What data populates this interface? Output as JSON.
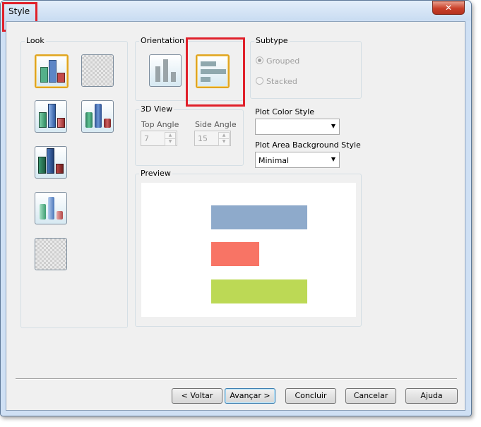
{
  "window": {
    "title": "Style",
    "close_glyph": "✕"
  },
  "look": {
    "label": "Look",
    "tiles": [
      {
        "name": "look-tile-flat-bars",
        "selected": true
      },
      {
        "name": "look-tile-transparent",
        "selected": false
      },
      {
        "name": "look-tile-beveled-bars",
        "selected": false
      },
      {
        "name": "look-tile-cylinder-bars",
        "selected": false
      },
      {
        "name": "look-tile-3d-bars",
        "selected": false
      },
      {
        "name": "look-tile-glossy-bars",
        "selected": false
      },
      {
        "name": "look-tile-transparent-2",
        "selected": false
      }
    ]
  },
  "orientation": {
    "label": "Orientation",
    "options": [
      "vertical",
      "horizontal"
    ],
    "selected": "horizontal"
  },
  "subtype": {
    "label": "Subtype",
    "grouped": "Grouped",
    "stacked": "Stacked",
    "selected": "Grouped"
  },
  "view3d": {
    "label": "3D View",
    "top_angle_label": "Top Angle",
    "top_angle": "7",
    "side_angle_label": "Side Angle",
    "side_angle": "15"
  },
  "plot_color": {
    "label": "Plot Color Style",
    "value": ""
  },
  "plot_bg": {
    "label": "Plot Area Background Style",
    "value": "Minimal"
  },
  "preview": {
    "label": "Preview",
    "bars": [
      {
        "color": "#8eaacb",
        "value": 1.0
      },
      {
        "color": "#f87465",
        "value": 0.5
      },
      {
        "color": "#bcd955",
        "value": 1.0
      }
    ]
  },
  "buttons": {
    "back": "< Voltar",
    "next": "Avançar >",
    "finish": "Concluir",
    "cancel": "Cancelar",
    "help": "Ajuda"
  },
  "colors": {
    "highlight_red": "#e0202a",
    "selected_border": "#e0a520"
  }
}
